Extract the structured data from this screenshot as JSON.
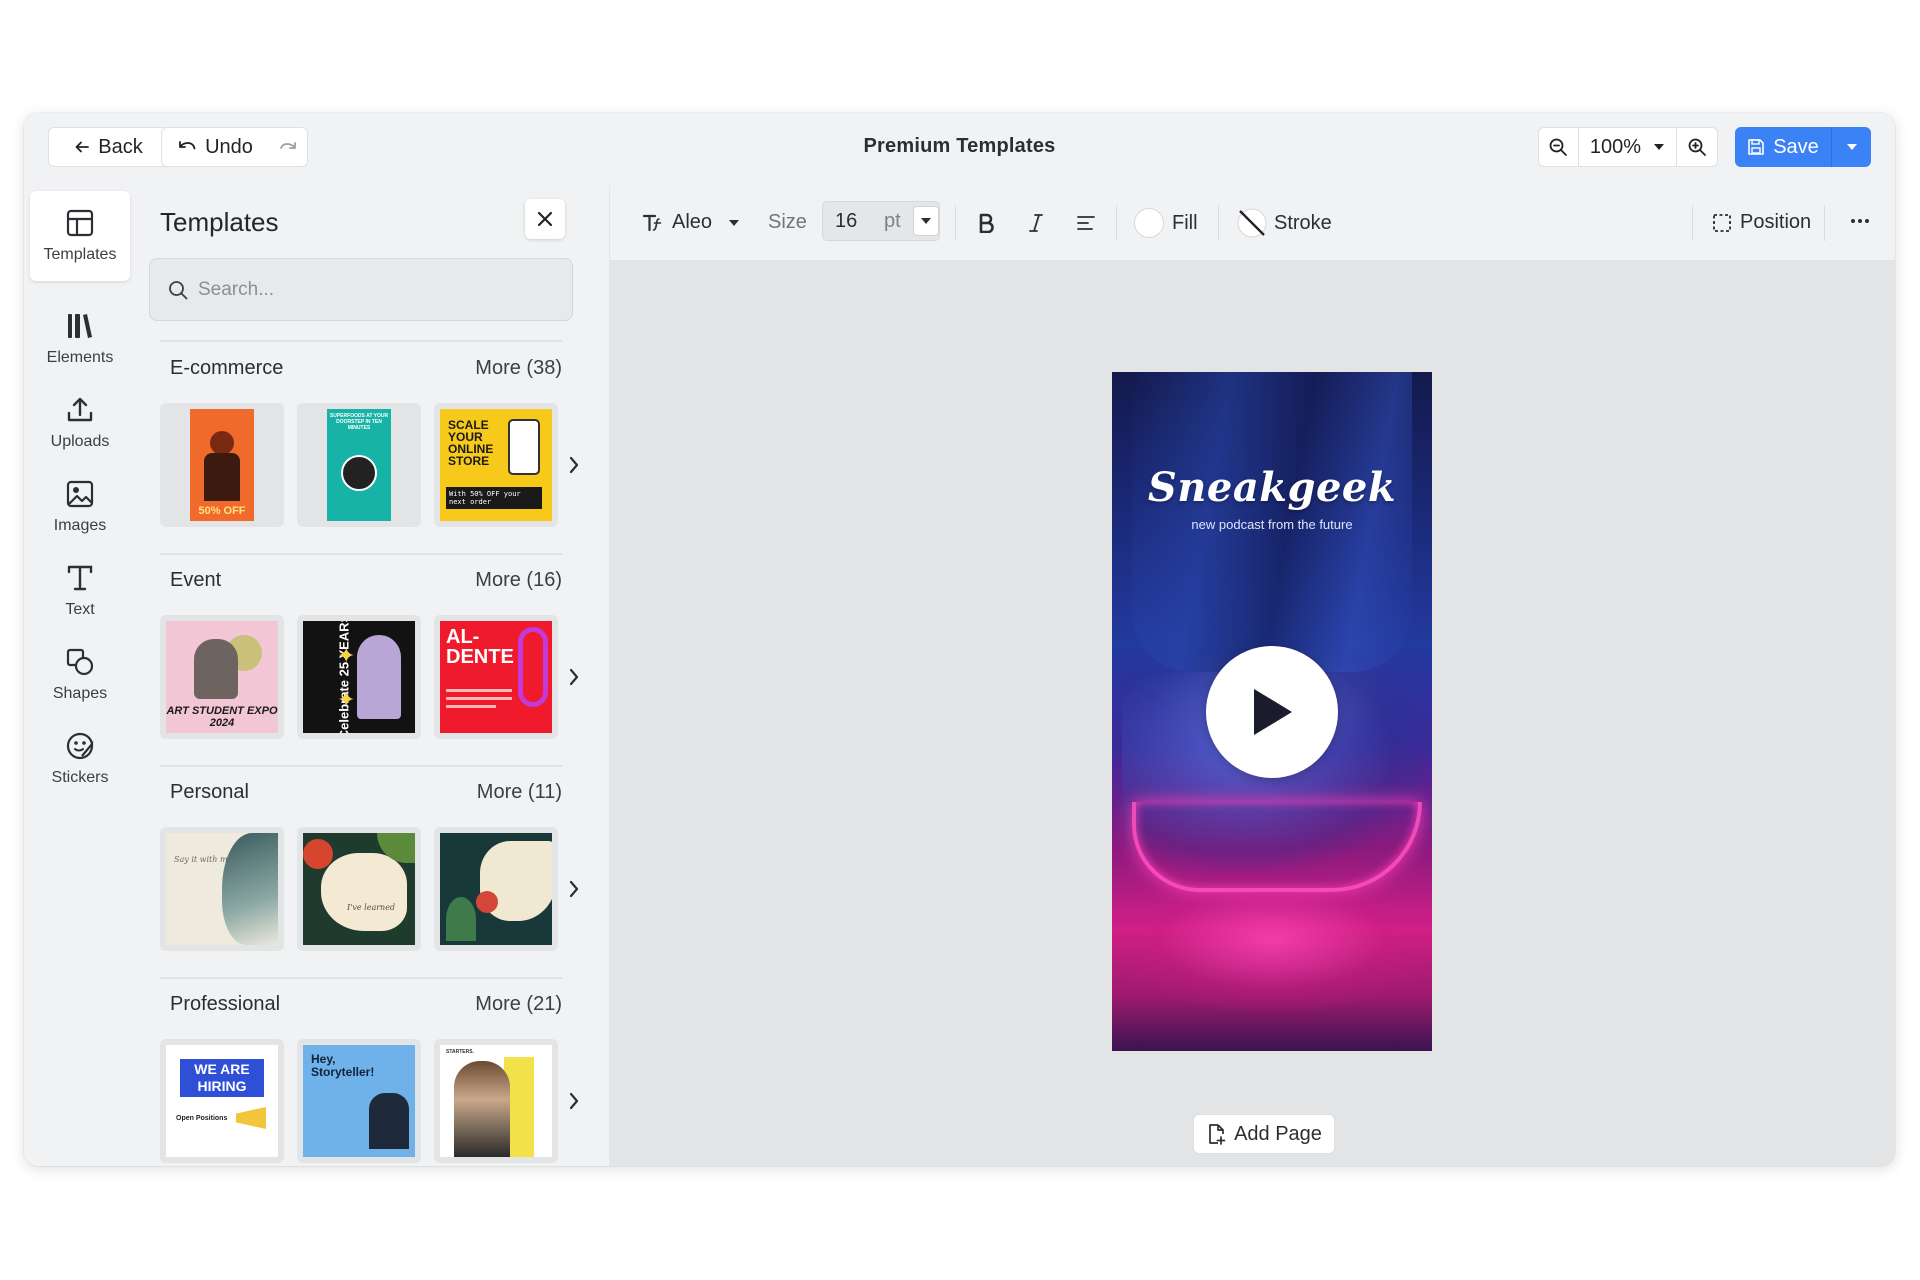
{
  "topbar": {
    "back_label": "Back",
    "undo_label": "Undo",
    "title": "Premium Templates",
    "zoom_value": "100%",
    "save_label": "Save"
  },
  "rail": {
    "items": [
      {
        "label": "Templates",
        "icon": "layout-icon",
        "active": true
      },
      {
        "label": "Elements",
        "icon": "library-icon"
      },
      {
        "label": "Uploads",
        "icon": "upload-icon"
      },
      {
        "label": "Images",
        "icon": "image-icon"
      },
      {
        "label": "Text",
        "icon": "text-icon"
      },
      {
        "label": "Shapes",
        "icon": "shapes-icon"
      },
      {
        "label": "Stickers",
        "icon": "sticker-icon"
      }
    ]
  },
  "panel": {
    "title": "Templates",
    "search_placeholder": "Search...",
    "categories": [
      {
        "name": "E-commerce",
        "more": "More (38)",
        "thumbs": [
          {
            "caption": "50% OFF"
          },
          {
            "caption": "SUPERFOODS AT YOUR DOORSTEP IN TEN MINUTES"
          },
          {
            "caption": "SCALE YOUR ONLINE STORE",
            "sub": "With 50% OFF your next order"
          }
        ]
      },
      {
        "name": "Event",
        "more": "More (16)",
        "thumbs": [
          {
            "caption": "ART STUDENT EXPO 2024"
          },
          {
            "caption": "Celebrate 25 YEARS"
          },
          {
            "caption": "AL-DENTE"
          }
        ]
      },
      {
        "name": "Personal",
        "more": "More (11)",
        "thumbs": [
          {
            "caption": "Say it with me"
          },
          {
            "caption": "I've learned"
          },
          {
            "caption": ""
          }
        ]
      },
      {
        "name": "Professional",
        "more": "More (21)",
        "thumbs": [
          {
            "caption": "WE ARE HIRING",
            "sub": "Open Positions"
          },
          {
            "caption": "Hey, Storyteller!"
          },
          {
            "caption": "STARTERS."
          }
        ]
      }
    ]
  },
  "toolbar": {
    "font": "Aleo",
    "size_label": "Size",
    "size_value": "16",
    "size_unit": "pt",
    "fill_label": "Fill",
    "stroke_label": "Stroke",
    "position_label": "Position"
  },
  "canvas": {
    "design_title": "Sneakgeek",
    "design_subtitle": "new podcast from the future",
    "add_page_label": "Add Page"
  },
  "colors": {
    "accent": "#3b82f6",
    "neon": "#ff3fb6"
  }
}
